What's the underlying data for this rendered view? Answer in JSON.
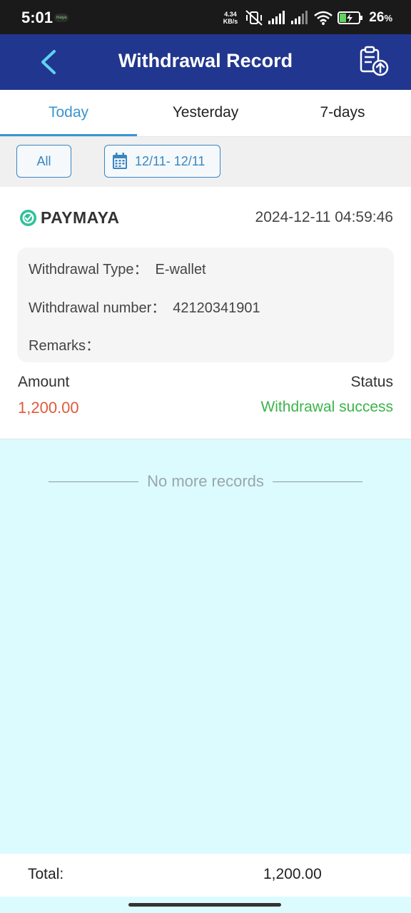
{
  "status_bar": {
    "time": "5:01",
    "app_badge": "maya",
    "net_speed_value": "4.34",
    "net_speed_unit": "KB/s",
    "battery_percent": "26",
    "battery_suffix": "%",
    "icons": [
      "vibrate-off-icon",
      "signal-icon",
      "signal-weak-icon",
      "wifi-icon",
      "battery-charging-icon"
    ]
  },
  "header": {
    "title": "Withdrawal Record",
    "back_icon": "chevron-left-icon",
    "action_icon": "clipboard-upload-icon"
  },
  "tabs": [
    {
      "label": "Today",
      "active": true
    },
    {
      "label": "Yesterday",
      "active": false
    },
    {
      "label": "7-days",
      "active": false
    }
  ],
  "filters": {
    "all_label": "All",
    "date_range": "12/11- 12/11",
    "date_icon": "calendar-icon"
  },
  "record": {
    "brand": "PAYMAYA",
    "datetime": "2024-12-11 04:59:46",
    "withdrawal_type_label": "Withdrawal Type：",
    "withdrawal_type_value": "E-wallet",
    "withdrawal_number_label": "Withdrawal number：",
    "withdrawal_number_value": "42120341901",
    "remarks_label": "Remarks：",
    "remarks_value": "",
    "amount_label": "Amount",
    "amount_value": "1,200.00",
    "status_label": "Status",
    "status_value": "Withdrawal success"
  },
  "list_end_text": "No more records",
  "footer": {
    "total_label": "Total:",
    "total_value": "1,200.00"
  },
  "colors": {
    "header_bg": "#21378f",
    "accent": "#3a94d0",
    "amount": "#e05a3c",
    "success": "#3cb44a",
    "list_bg": "#dcfbff"
  }
}
